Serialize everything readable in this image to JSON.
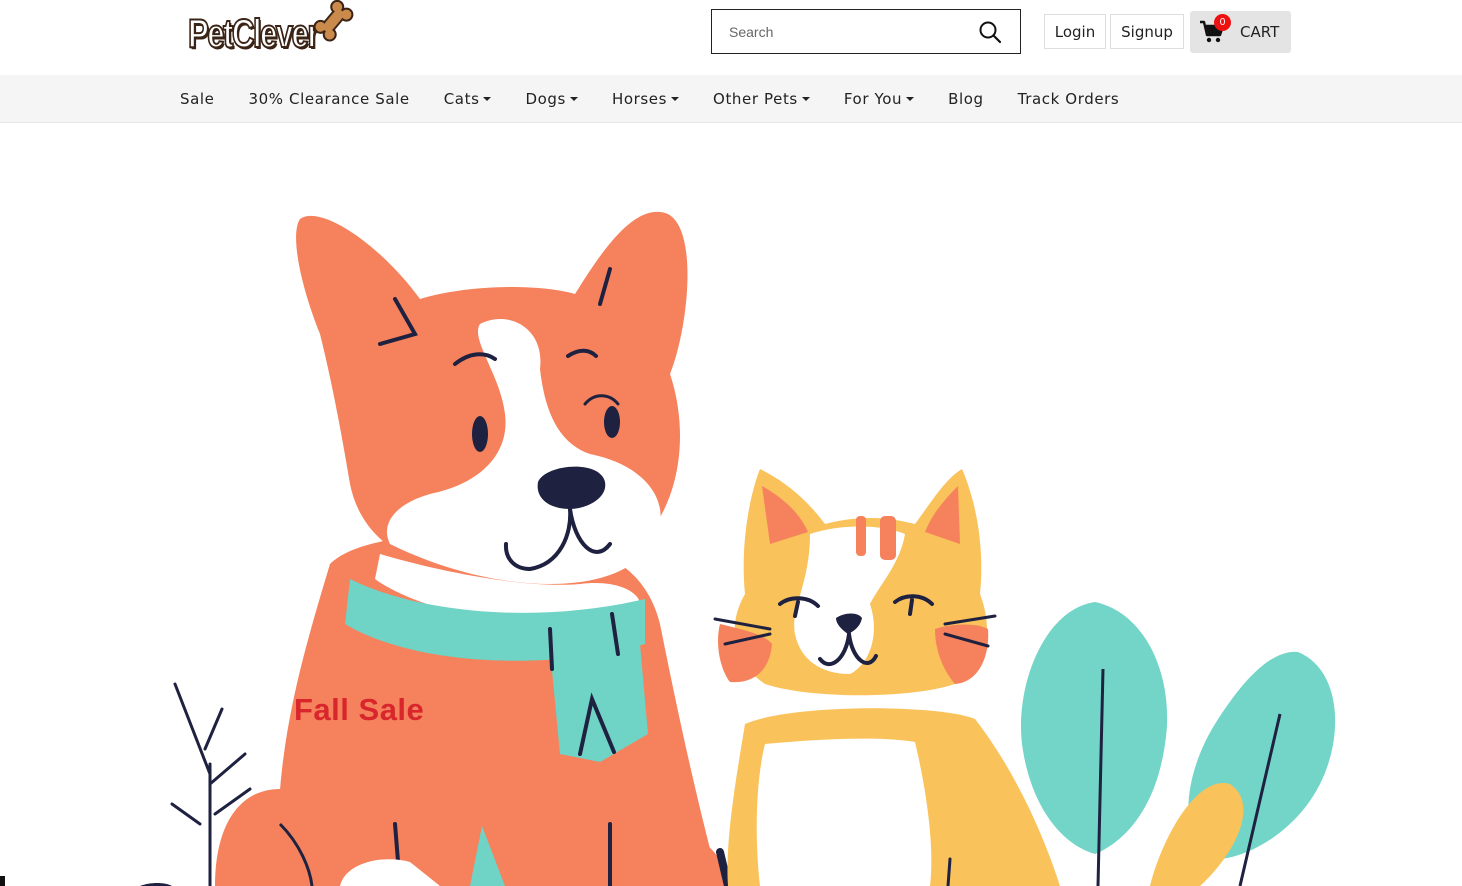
{
  "brand": {
    "name": "PetClever",
    "logo_icon": "bone-icon"
  },
  "search": {
    "placeholder": "Search",
    "icon": "search-icon"
  },
  "auth": {
    "login_label": "Login",
    "signup_label": "Signup"
  },
  "cart": {
    "label": "CART",
    "count": "0",
    "icon": "cart-icon"
  },
  "nav": {
    "items": [
      {
        "label": "Sale",
        "dropdown": false
      },
      {
        "label": "30% Clearance Sale",
        "dropdown": false
      },
      {
        "label": "Cats",
        "dropdown": true
      },
      {
        "label": "Dogs",
        "dropdown": true
      },
      {
        "label": "Horses",
        "dropdown": true
      },
      {
        "label": "Other Pets",
        "dropdown": true
      },
      {
        "label": "For You",
        "dropdown": true
      },
      {
        "label": "Blog",
        "dropdown": false
      },
      {
        "label": "Track Orders",
        "dropdown": false
      }
    ]
  },
  "hero": {
    "title": "Fall Sale"
  },
  "colors": {
    "dog": "#f5825c",
    "cat": "#f9c25b",
    "scarf": "#6fd3c5",
    "sale_text": "#d8262c",
    "cart_badge": "#e11111"
  }
}
